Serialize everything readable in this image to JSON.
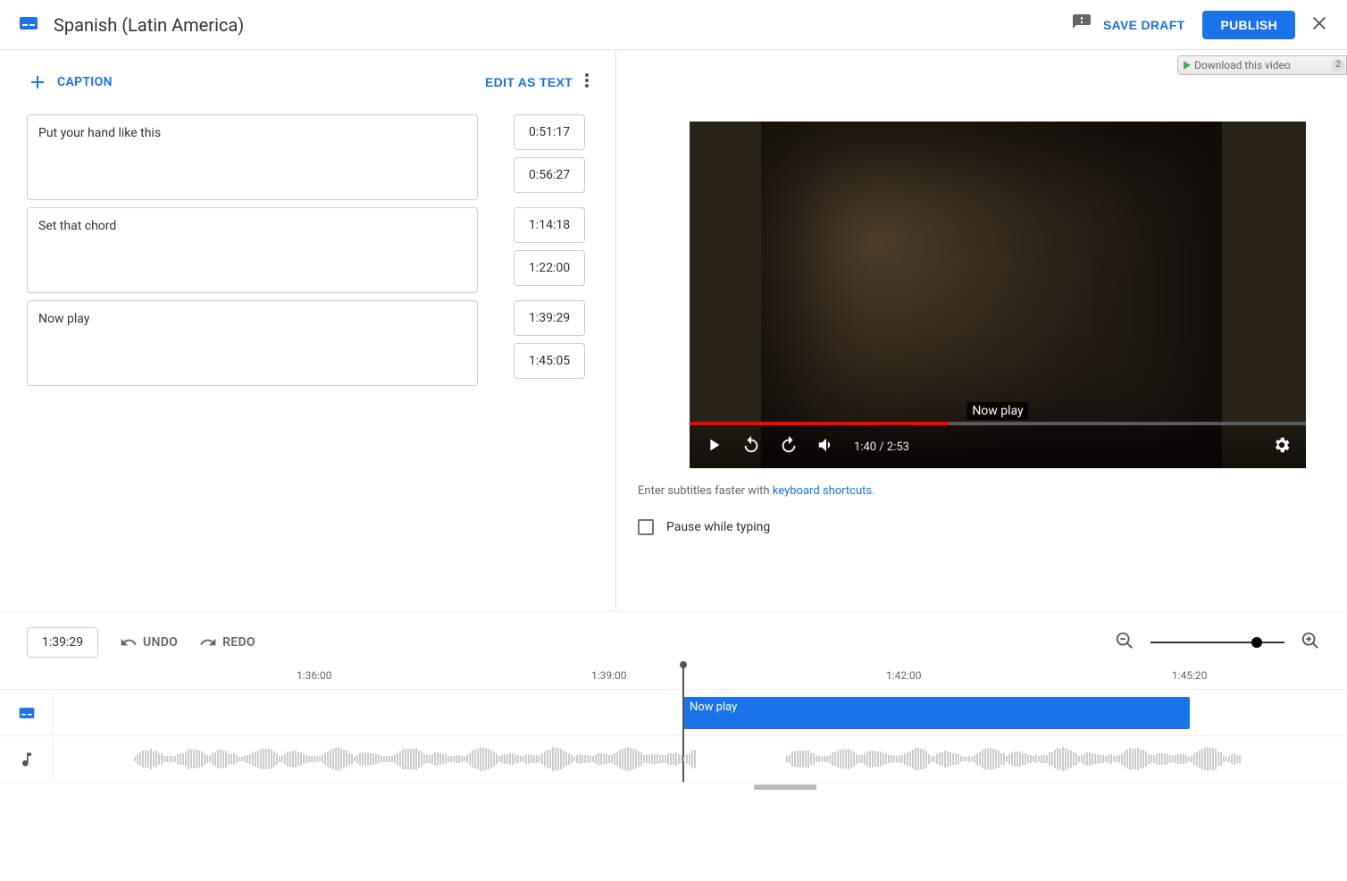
{
  "header": {
    "title": "Spanish (Latin America)",
    "save_draft": "SAVE DRAFT",
    "publish": "PUBLISH"
  },
  "left": {
    "add_caption": "CAPTION",
    "edit_as_text": "EDIT AS TEXT",
    "captions": [
      {
        "text": "Put your hand like this",
        "start": "0:51:17",
        "end": "0:56:27"
      },
      {
        "text": "Set that chord",
        "start": "1:14:18",
        "end": "1:22:00"
      },
      {
        "text": "Now play",
        "start": "1:39:29",
        "end": "1:45:05"
      }
    ]
  },
  "right": {
    "download_label": "Download this video",
    "download_count": "2",
    "overlay_caption": "Now play",
    "time_current": "1:40",
    "time_total": "2:53",
    "hint_prefix": "Enter subtitles faster with ",
    "hint_link": "keyboard shortcuts",
    "hint_suffix": ".",
    "pause_label": "Pause while typing"
  },
  "timeline": {
    "current": "1:39:29",
    "undo": "UNDO",
    "redo": "REDO",
    "ticks": [
      "1:36:00",
      "1:39:00",
      "1:42:00",
      "1:45:20"
    ],
    "block_label": "Now play"
  }
}
